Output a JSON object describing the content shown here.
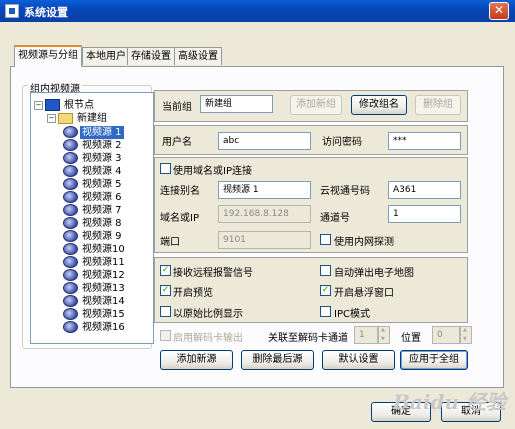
{
  "window": {
    "title": "系统设置"
  },
  "tabs": [
    "视频源与分组",
    "本地用户",
    "存储设置",
    "高级设置"
  ],
  "group_box_label": "组内视频源",
  "tree": {
    "root": "根节点",
    "group": "新建组",
    "sources": [
      "视频源 1",
      "视频源 2",
      "视频源 3",
      "视频源 4",
      "视频源 5",
      "视频源 6",
      "视频源 7",
      "视频源 8",
      "视频源 9",
      "视频源10",
      "视频源11",
      "视频源12",
      "视频源13",
      "视频源14",
      "视频源15",
      "视频源16"
    ],
    "selected_index": 0
  },
  "group_section": {
    "current_group_label": "当前组",
    "current_group_value": "新建组",
    "add_group": "添加新组",
    "rename_group": "修改组名",
    "delete_group": "删除组"
  },
  "credentials": {
    "username_label": "用户名",
    "username_value": "abc",
    "password_label": "访问密码",
    "password_value": "***"
  },
  "connection": {
    "use_domain_label": "使用域名或IP连接",
    "use_domain_checked": false,
    "alias_label": "连接别名",
    "alias_value": "视频源 1",
    "cloud_label": "云视通号码",
    "cloud_value": "A361",
    "domain_label": "域名或IP",
    "domain_value": "192.168.8.128",
    "channel_label": "通道号",
    "channel_value": "1",
    "port_label": "端口",
    "port_value": "9101",
    "lan_probe_label": "使用内网探测",
    "lan_probe_checked": false
  },
  "options": {
    "alarm_label": "接收远程报警信号",
    "alarm_checked": true,
    "emap_label": "自动弹出电子地图",
    "emap_checked": false,
    "preview_label": "开启预览",
    "preview_checked": true,
    "float_label": "开启悬浮窗口",
    "float_checked": true,
    "ratio_label": "以原始比例显示",
    "ratio_checked": false,
    "ipc_label": "IPC模式",
    "ipc_checked": false
  },
  "decode": {
    "enable_label": "启用解码卡输出",
    "channel_label": "关联至解码卡通道",
    "channel_value": "1",
    "position_label": "位置",
    "position_value": "0"
  },
  "source_buttons": {
    "add": "添加新源",
    "delete_last": "删除最后源",
    "default": "默认设置",
    "apply_all": "应用于全组"
  },
  "dialog_buttons": {
    "ok": "确定",
    "cancel": "取消"
  },
  "watermark": "Baidu 经验"
}
